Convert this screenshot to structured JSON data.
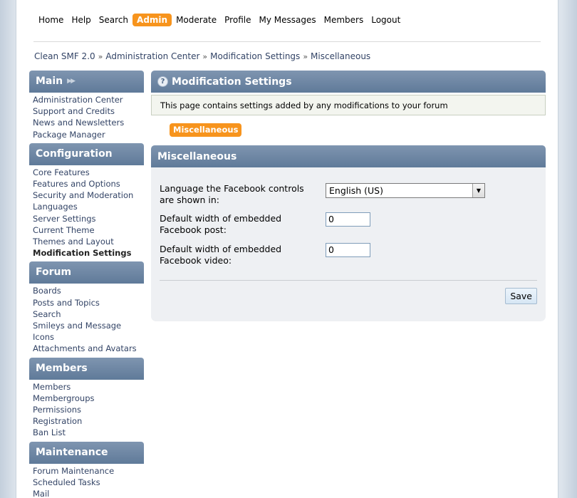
{
  "topmenu": {
    "items": [
      "Home",
      "Help",
      "Search",
      "Admin",
      "Moderate",
      "Profile",
      "My Messages",
      "Members",
      "Logout"
    ],
    "active": "Admin"
  },
  "breadcrumb": [
    "Clean SMF 2.0",
    "Administration Center",
    "Modification Settings",
    "Miscellaneous"
  ],
  "breadcrumb_separator": "»",
  "sidebar": {
    "sections": [
      {
        "title": "Main",
        "items": [
          "Administration Center",
          "Support and Credits",
          "News and Newsletters",
          "Package Manager"
        ]
      },
      {
        "title": "Configuration",
        "items": [
          "Core Features",
          "Features and Options",
          "Security and Moderation",
          "Languages",
          "Server Settings",
          "Current Theme",
          "Themes and Layout",
          "Modification Settings"
        ]
      },
      {
        "title": "Forum",
        "items": [
          "Boards",
          "Posts and Topics",
          "Search",
          "Smileys and Message Icons",
          "Attachments and Avatars"
        ]
      },
      {
        "title": "Members",
        "items": [
          "Members",
          "Membergroups",
          "Permissions",
          "Registration",
          "Ban List"
        ]
      },
      {
        "title": "Maintenance",
        "items": [
          "Forum Maintenance",
          "Scheduled Tasks",
          "Mail"
        ]
      }
    ],
    "current_item": "Modification Settings"
  },
  "content": {
    "title": "Modification Settings",
    "help_icon": "?",
    "description": "This page contains settings added by any modifications to your forum",
    "tab_label": "Miscellaneous",
    "section_title": "Miscellaneous",
    "settings": {
      "language_label_1": "Language the Facebook controls",
      "language_label_2": "are shown in:",
      "language_value": "English (US)",
      "post_width_label_1": "Default width of embedded",
      "post_width_label_2": "Facebook post:",
      "post_width_value": "0",
      "video_width_label_1": "Default width of embedded",
      "video_width_label_2": "Facebook video:",
      "video_width_value": "0"
    },
    "save_label": "Save"
  },
  "colors": {
    "accent": "#f7941d",
    "header_blue": "#6b84a3",
    "link": "#334466"
  }
}
